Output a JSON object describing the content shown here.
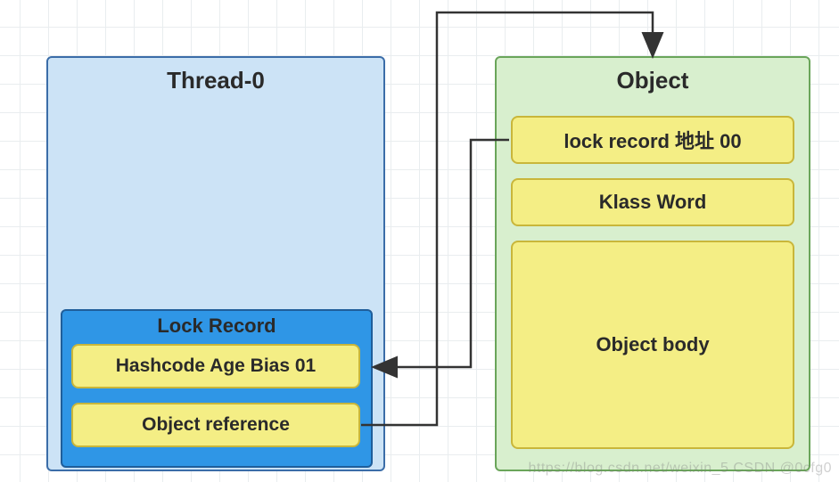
{
  "thread": {
    "title": "Thread-0",
    "lock_record": {
      "title": "Lock Record",
      "hashcode_label": "Hashcode Age Bias 01",
      "objref_label": "Object reference"
    }
  },
  "object": {
    "title": "Object",
    "lock_record_addr_label": "lock record 地址 00",
    "klass_label": "Klass Word",
    "body_label": "Object body"
  },
  "watermark": "https://blog.csdn.net/weixin_5   CSDN @0cfg0"
}
